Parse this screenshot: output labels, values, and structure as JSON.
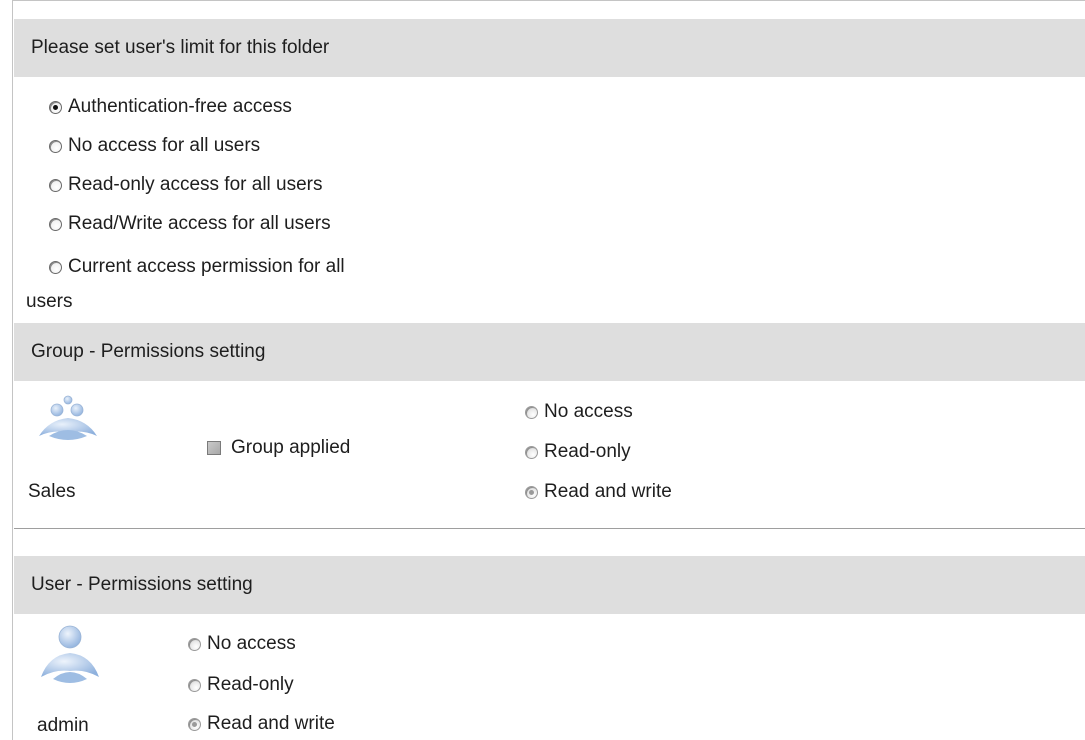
{
  "folder_limit": {
    "header": "Please set user's limit for this folder",
    "options": [
      {
        "label": "Authentication-free access",
        "checked": true
      },
      {
        "label": "No access for all users",
        "checked": false
      },
      {
        "label": "Read-only access for all users",
        "checked": false
      },
      {
        "label": "Read/Write access for all users",
        "checked": false
      },
      {
        "label_line1": "Current access permission for all",
        "label_line2": "users",
        "checked": false
      }
    ]
  },
  "group_permissions": {
    "header": "Group - Permissions setting",
    "group_name": "Sales",
    "group_icon": "user-group-icon",
    "group_applied_label": "Group applied",
    "group_applied_checked": true,
    "options": [
      {
        "label": "No access",
        "checked": false
      },
      {
        "label": "Read-only",
        "checked": false
      },
      {
        "label": "Read and write",
        "checked": true
      }
    ]
  },
  "user_permissions": {
    "header": "User - Permissions setting",
    "user_name": "admin",
    "user_icon": "user-icon",
    "options": [
      {
        "label": "No access",
        "checked": false
      },
      {
        "label": "Read-only",
        "checked": false
      },
      {
        "label": "Read and write",
        "checked": true
      }
    ]
  },
  "colors": {
    "header_bg": "#dedede",
    "icon_blue": "#a9c4e4",
    "divider": "#9e9e9e"
  }
}
